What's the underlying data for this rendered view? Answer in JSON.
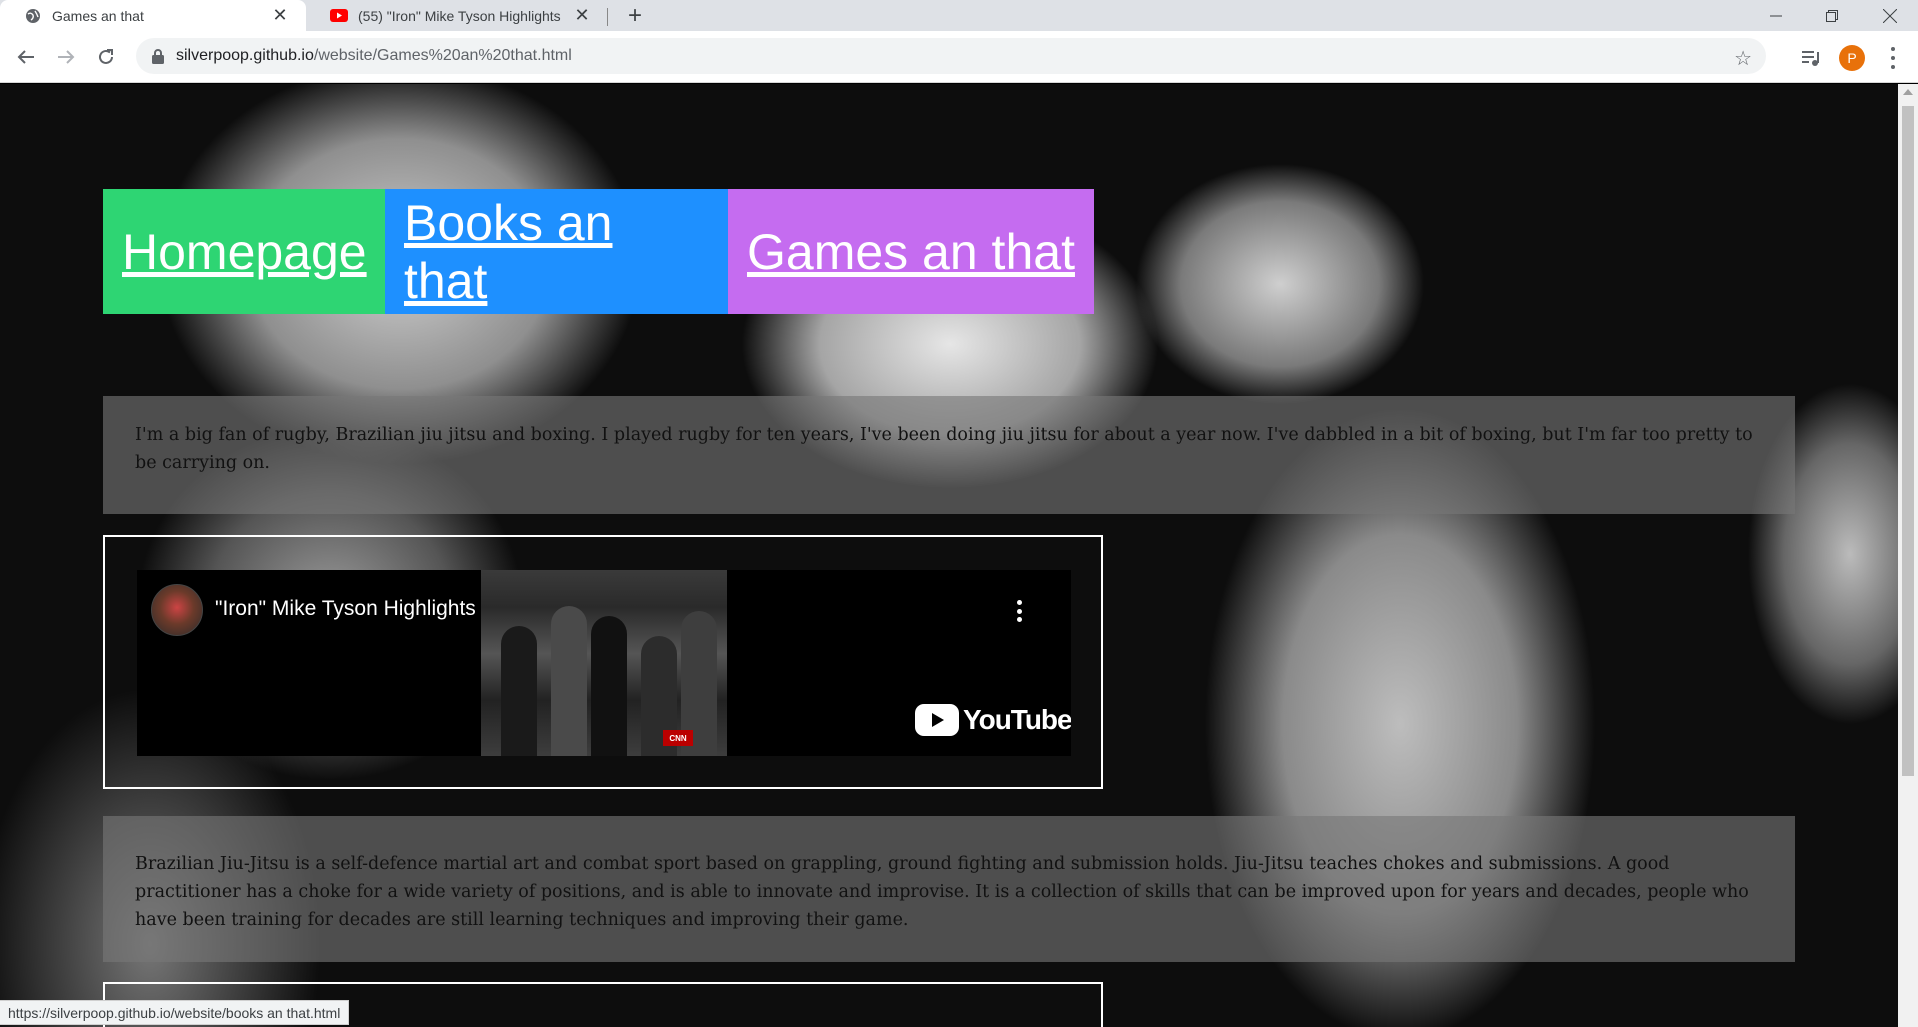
{
  "tabs": [
    {
      "title": "Games an that",
      "icon": "globe-icon",
      "active": true
    },
    {
      "title": "(55) \"Iron\" Mike Tyson Highlights",
      "icon": "youtube-icon",
      "active": false
    }
  ],
  "address_bar": {
    "domain": "silverpoop.github.io",
    "path": "/website/Games%20an%20that.html"
  },
  "profile": {
    "initial": "P",
    "color": "#e8710a"
  },
  "nav": {
    "home": "Homepage",
    "books": "Books an that",
    "games": "Games an that",
    "colors": {
      "home": "#2ed573",
      "books": "#1e90ff",
      "games": "#c56cf0"
    }
  },
  "content": {
    "intro": "I'm a big fan of rugby, Brazilian jiu jitsu and boxing. I played rugby for ten years, I've been doing jiu jitsu for about a year now. I've dabbled in a bit of boxing, but I'm far too pretty to be carrying on.",
    "video": {
      "title": "\"Iron\" Mike Tyson Highlights",
      "brand": "YouTube",
      "thumb_badge": "CNN"
    },
    "bjj": "Brazilian Jiu-Jitsu is a self-defence martial art and combat sport based on grappling, ground fighting and submission holds. Jiu-Jitsu teaches chokes and submissions. A good practitioner has a choke for a wide variety of positions, and is able to innovate and improvise. It is a collection of skills that can be improved upon for years and decades, people who have been training for decades are still learning techniques and improving their game."
  },
  "status_url": "https://silverpoop.github.io/website/books an that.html"
}
